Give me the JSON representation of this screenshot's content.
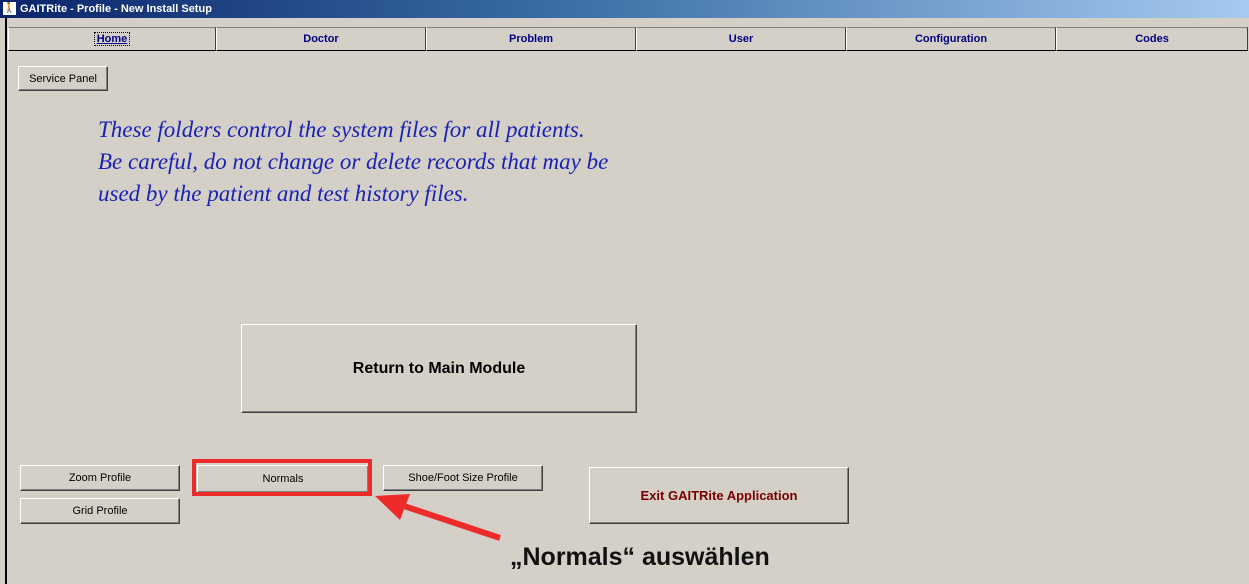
{
  "window": {
    "title": "GAITRite - Profile - New Install Setup"
  },
  "tabs": [
    {
      "label": "Home",
      "active": true
    },
    {
      "label": "Doctor"
    },
    {
      "label": "Problem"
    },
    {
      "label": "User"
    },
    {
      "label": "Configuration"
    },
    {
      "label": "Codes"
    }
  ],
  "buttons": {
    "service_panel": "Service Panel",
    "return_main": "Return to Main Module",
    "zoom_profile": "Zoom Profile",
    "normals": "Normals",
    "shoe_foot": "Shoe/Foot Size Profile",
    "grid_profile": "Grid Profile",
    "exit_app": "Exit GAITRite Application"
  },
  "notice": {
    "line1": "These folders control the system files for all patients.",
    "line2": "Be careful, do not change or delete records that may be",
    "line3": "used by the patient and test history files."
  },
  "annotation": {
    "text": "„Normals“ auswählen"
  },
  "colors": {
    "notice_text": "#1a22b3",
    "tab_text": "#000080",
    "exit_text": "#7a0000",
    "highlight": "#ee2b2b"
  }
}
